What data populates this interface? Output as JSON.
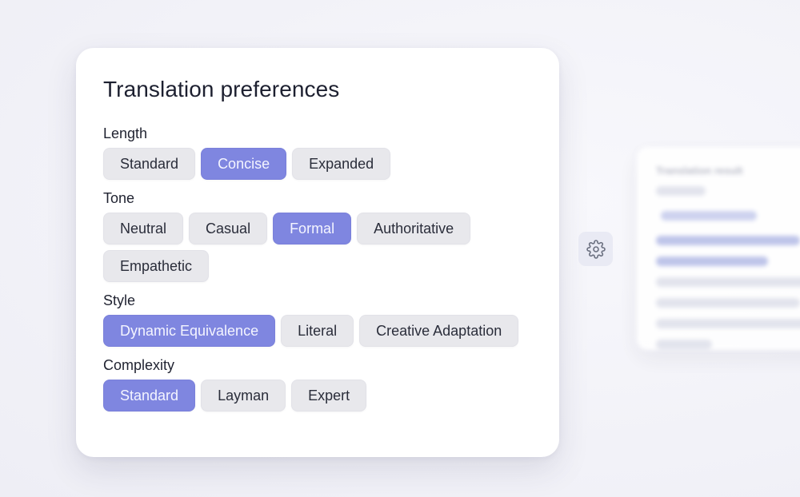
{
  "panel": {
    "title": "Translation preferences",
    "groups": [
      {
        "label": "Length",
        "options": [
          "Standard",
          "Concise",
          "Expanded"
        ],
        "selected": "Concise"
      },
      {
        "label": "Tone",
        "options": [
          "Neutral",
          "Casual",
          "Formal",
          "Authoritative",
          "Empathetic"
        ],
        "selected": "Formal"
      },
      {
        "label": "Style",
        "options": [
          "Dynamic Equivalence",
          "Literal",
          "Creative Adaptation"
        ],
        "selected": "Dynamic Equivalence"
      },
      {
        "label": "Complexity",
        "options": [
          "Standard",
          "Layman",
          "Expert"
        ],
        "selected": "Standard"
      }
    ]
  },
  "settings_button": {
    "icon": "gear-icon"
  },
  "result_preview": {
    "title": "Translation result"
  },
  "colors": {
    "accent": "#7f86e0",
    "chip_bg": "#e8e8ec",
    "background": "#f4f4f9"
  }
}
